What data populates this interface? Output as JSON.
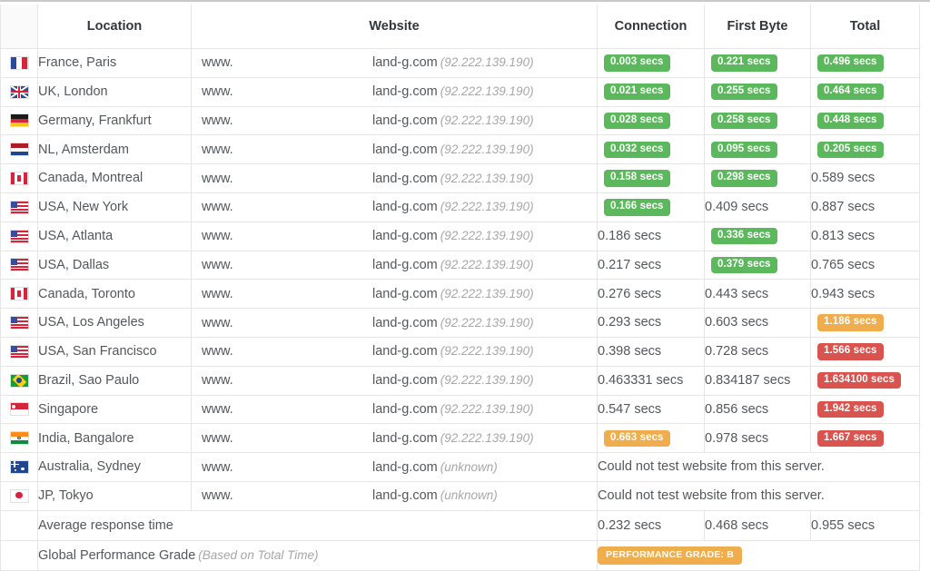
{
  "table": {
    "headers": {
      "flag": "",
      "location": "Location",
      "website": "Website",
      "connection": "Connection",
      "first_byte": "First Byte",
      "total": "Total"
    },
    "website_prefix": "www.",
    "website_suffix": "land-g.com",
    "rows": [
      {
        "flag": "fr",
        "location": "France, Paris",
        "website_ip": "(92.222.139.190)",
        "connection": "0.003 secs",
        "connection_badge": "green",
        "first_byte": "0.221 secs",
        "first_byte_badge": "green",
        "total": "0.496 secs",
        "total_badge": "green",
        "error": null
      },
      {
        "flag": "gb",
        "location": "UK, London",
        "website_ip": "(92.222.139.190)",
        "connection": "0.021 secs",
        "connection_badge": "green",
        "first_byte": "0.255 secs",
        "first_byte_badge": "green",
        "total": "0.464 secs",
        "total_badge": "green",
        "error": null
      },
      {
        "flag": "de",
        "location": "Germany, Frankfurt",
        "website_ip": "(92.222.139.190)",
        "connection": "0.028 secs",
        "connection_badge": "green",
        "first_byte": "0.258 secs",
        "first_byte_badge": "green",
        "total": "0.448 secs",
        "total_badge": "green",
        "error": null
      },
      {
        "flag": "nl",
        "location": "NL, Amsterdam",
        "website_ip": "(92.222.139.190)",
        "connection": "0.032 secs",
        "connection_badge": "green",
        "first_byte": "0.095 secs",
        "first_byte_badge": "green",
        "total": "0.205 secs",
        "total_badge": "green",
        "error": null
      },
      {
        "flag": "ca",
        "location": "Canada, Montreal",
        "website_ip": "(92.222.139.190)",
        "connection": "0.158 secs",
        "connection_badge": "green",
        "first_byte": "0.298 secs",
        "first_byte_badge": "green",
        "total": "0.589 secs",
        "total_badge": "none",
        "error": null
      },
      {
        "flag": "us",
        "location": "USA, New York",
        "website_ip": "(92.222.139.190)",
        "connection": "0.166 secs",
        "connection_badge": "green",
        "first_byte": "0.409 secs",
        "first_byte_badge": "none",
        "total": "0.887 secs",
        "total_badge": "none",
        "error": null
      },
      {
        "flag": "us",
        "location": "USA, Atlanta",
        "website_ip": "(92.222.139.190)",
        "connection": "0.186 secs",
        "connection_badge": "none",
        "first_byte": "0.336 secs",
        "first_byte_badge": "green",
        "total": "0.813 secs",
        "total_badge": "none",
        "error": null
      },
      {
        "flag": "us",
        "location": "USA, Dallas",
        "website_ip": "(92.222.139.190)",
        "connection": "0.217 secs",
        "connection_badge": "none",
        "first_byte": "0.379 secs",
        "first_byte_badge": "green",
        "total": "0.765 secs",
        "total_badge": "none",
        "error": null
      },
      {
        "flag": "ca",
        "location": "Canada, Toronto",
        "website_ip": "(92.222.139.190)",
        "connection": "0.276 secs",
        "connection_badge": "none",
        "first_byte": "0.443 secs",
        "first_byte_badge": "none",
        "total": "0.943 secs",
        "total_badge": "none",
        "error": null
      },
      {
        "flag": "us",
        "location": "USA, Los Angeles",
        "website_ip": "(92.222.139.190)",
        "connection": "0.293 secs",
        "connection_badge": "none",
        "first_byte": "0.603 secs",
        "first_byte_badge": "none",
        "total": "1.186 secs",
        "total_badge": "orange",
        "error": null
      },
      {
        "flag": "us",
        "location": "USA, San Francisco",
        "website_ip": "(92.222.139.190)",
        "connection": "0.398 secs",
        "connection_badge": "none",
        "first_byte": "0.728 secs",
        "first_byte_badge": "none",
        "total": "1.566 secs",
        "total_badge": "red",
        "error": null
      },
      {
        "flag": "br",
        "location": "Brazil, Sao Paulo",
        "website_ip": "(92.222.139.190)",
        "connection": "0.463331 secs",
        "connection_badge": "none",
        "first_byte": "0.834187 secs",
        "first_byte_badge": "none",
        "total": "1.634100 secs",
        "total_badge": "red",
        "error": null
      },
      {
        "flag": "sg",
        "location": "Singapore",
        "website_ip": "(92.222.139.190)",
        "connection": "0.547 secs",
        "connection_badge": "none",
        "first_byte": "0.856 secs",
        "first_byte_badge": "none",
        "total": "1.942 secs",
        "total_badge": "red",
        "error": null
      },
      {
        "flag": "in",
        "location": "India, Bangalore",
        "website_ip": "(92.222.139.190)",
        "connection": "0.663 secs",
        "connection_badge": "orange",
        "first_byte": "0.978 secs",
        "first_byte_badge": "none",
        "total": "1.667 secs",
        "total_badge": "red",
        "error": null
      },
      {
        "flag": "au",
        "location": "Australia, Sydney",
        "website_ip": "(unknown)",
        "connection": null,
        "connection_badge": "none",
        "first_byte": null,
        "first_byte_badge": "none",
        "total": null,
        "total_badge": "none",
        "error": "Could not test website from this server."
      },
      {
        "flag": "jp",
        "location": "JP, Tokyo",
        "website_ip": "(unknown)",
        "connection": null,
        "connection_badge": "none",
        "first_byte": null,
        "first_byte_badge": "none",
        "total": null,
        "total_badge": "none",
        "error": "Could not test website from this server."
      }
    ],
    "footer": {
      "average_label": "Average response time",
      "average_connection": "0.232 secs",
      "average_first_byte": "0.468 secs",
      "average_total": "0.955 secs",
      "grade_label": "Global Performance Grade",
      "grade_note": "(Based on Total Time)",
      "grade_badge": "PERFORMANCE GRADE: B"
    }
  },
  "colors": {
    "green": "#5cb85c",
    "orange": "#f0ad4e",
    "red": "#d9534f",
    "header_bg": "#f5f5f5",
    "border": "#e6e6e6",
    "text": "#53585c",
    "muted": "#a7a7a7"
  }
}
